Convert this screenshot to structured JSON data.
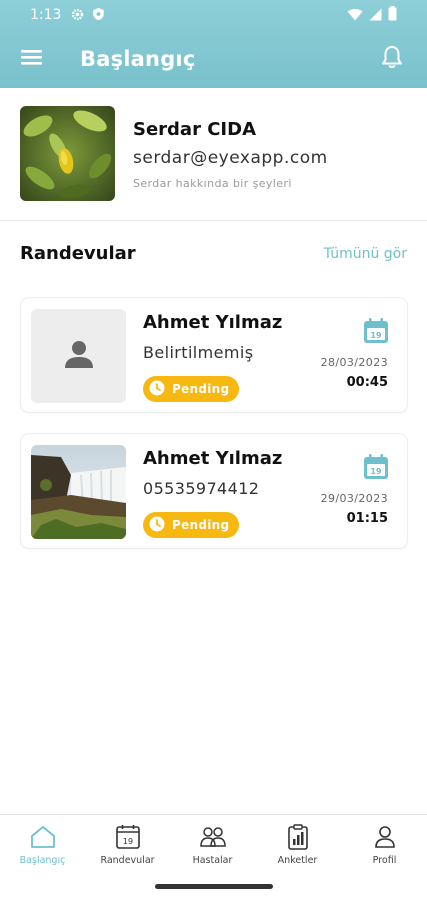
{
  "status_bar": {
    "time": "1:13",
    "icons": [
      "gear-icon",
      "shield-icon",
      "wifi-icon",
      "signal-icon",
      "battery-icon"
    ]
  },
  "app_bar": {
    "title": "Başlangıç",
    "icons": [
      "menu-icon",
      "bell-icon"
    ]
  },
  "profile": {
    "name": "Serdar CIDA",
    "email": "serdar@eyexapp.com",
    "bio": "Serdar hakkında bir şeyleri"
  },
  "appointments_section": {
    "title": "Randevular",
    "see_all_label": "Tümünü gör"
  },
  "appointments": [
    {
      "name": "Ahmet Yılmaz",
      "detail": "Belirtilmemiş",
      "status": "Pending",
      "date": "28/03/2023",
      "time": "00:45",
      "image": "person-placeholder-icon"
    },
    {
      "name": "Ahmet Yılmaz",
      "detail": "05535974412",
      "status": "Pending",
      "date": "29/03/2023",
      "time": "01:15",
      "image": "waterfall-photo"
    }
  ],
  "bottom_nav": {
    "items": [
      {
        "label": "Başlangıç",
        "icon": "home-icon",
        "active": true
      },
      {
        "label": "Randevular",
        "icon": "calendar-icon",
        "active": false
      },
      {
        "label": "Hastalar",
        "icon": "patients-icon",
        "active": false
      },
      {
        "label": "Anketler",
        "icon": "survey-chart-icon",
        "active": false
      },
      {
        "label": "Profil",
        "icon": "profile-icon",
        "active": false
      }
    ]
  },
  "colors": {
    "header": "#7fc6d0",
    "accent": "#6fc0cf",
    "pending_badge": "#f7b812",
    "calendar_icon": "#6fc0cf"
  }
}
